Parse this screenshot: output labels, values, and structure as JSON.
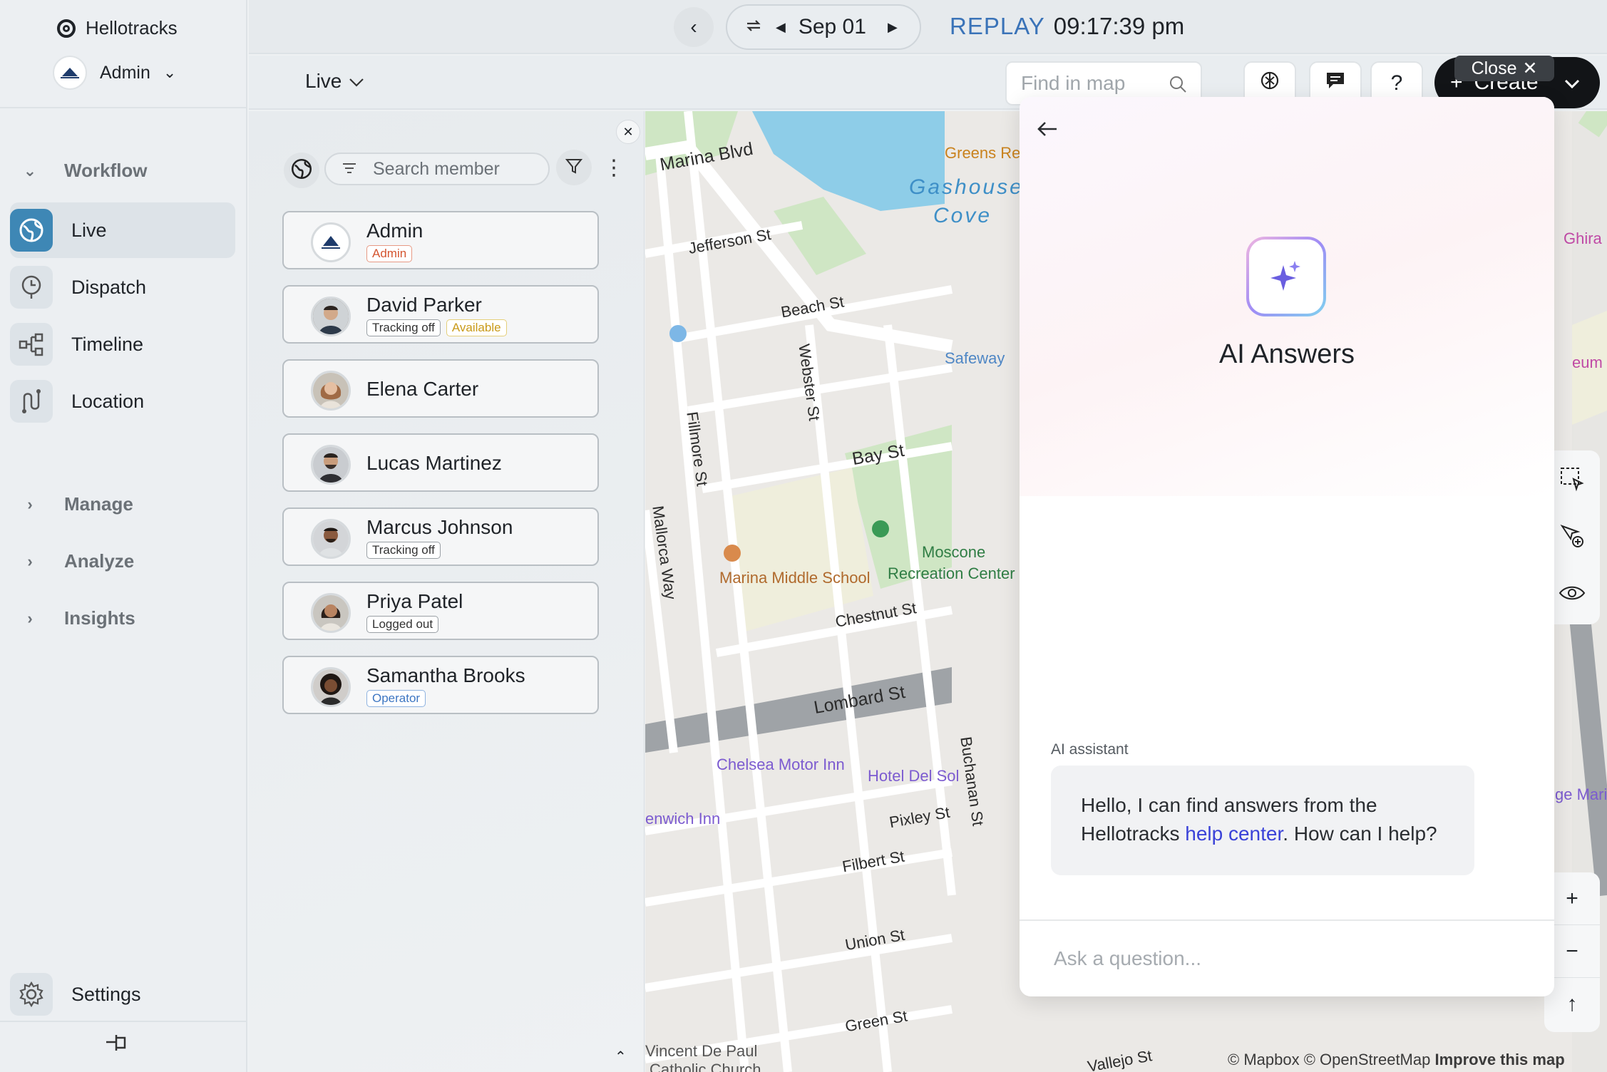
{
  "app": {
    "name": "Hellotracks",
    "account": "Admin"
  },
  "sidebar": {
    "groups": [
      {
        "label": "Workflow",
        "caret": "⌄"
      },
      {
        "label": "Manage",
        "caret": "›"
      },
      {
        "label": "Analyze",
        "caret": "›"
      },
      {
        "label": "Insights",
        "caret": "›"
      }
    ],
    "items": [
      {
        "label": "Live",
        "icon": "globe-icon",
        "active": true
      },
      {
        "label": "Dispatch",
        "icon": "dispatch-icon"
      },
      {
        "label": "Timeline",
        "icon": "timeline-icon"
      },
      {
        "label": "Location",
        "icon": "location-icon"
      }
    ],
    "settings": "Settings"
  },
  "topbar": {
    "date": "Sep 01",
    "replay_label": "REPLAY",
    "replay_time": "09:17:39 pm",
    "view": "Live",
    "find_placeholder": "Find in map",
    "help": "?",
    "create": "Create",
    "close": "Close"
  },
  "members": {
    "search_placeholder": "Search member",
    "list": [
      {
        "name": "Admin",
        "badges": [
          {
            "text": "Admin",
            "kind": "admin"
          }
        ]
      },
      {
        "name": "David Parker",
        "badges": [
          {
            "text": "Tracking off",
            "kind": "plain"
          },
          {
            "text": "Available",
            "kind": "available"
          }
        ]
      },
      {
        "name": "Elena Carter",
        "badges": []
      },
      {
        "name": "Lucas Martinez",
        "badges": []
      },
      {
        "name": "Marcus Johnson",
        "badges": [
          {
            "text": "Tracking off",
            "kind": "plain"
          }
        ]
      },
      {
        "name": "Priya Patel",
        "badges": [
          {
            "text": "Logged out",
            "kind": "plain"
          }
        ]
      },
      {
        "name": "Samantha Brooks",
        "badges": [
          {
            "text": "Operator",
            "kind": "operator"
          }
        ]
      }
    ]
  },
  "map": {
    "labels": {
      "marina_blvd": "Marina Blvd",
      "jefferson": "Jefferson St",
      "beach": "Beach St",
      "fillmore": "Fillmore St",
      "webster": "Webster St",
      "bay": "Bay St",
      "mallorca": "Mallorca Way",
      "chestnut": "Chestnut St",
      "lombard": "Lombard St",
      "pixley": "Pixley St",
      "filbert": "Filbert St",
      "union": "Union St",
      "green": "Green St",
      "vallejo": "Vallejo St",
      "buchanan": "Buchanan St",
      "safeway": "Safeway",
      "greens": "Greens Re",
      "gashouse": "Gashouse",
      "cove": "Cove",
      "marina_school": "Marina Middle School",
      "moscone": "Moscone",
      "moscone2": "Recreation Center",
      "chelsea": "Chelsea Motor Inn",
      "hotel_del_sol": "Hotel Del Sol",
      "greenwich": "enwich Inn",
      "vincent": "Vincent De Paul",
      "vincent2": "Catholic Church",
      "ghira": "Ghira",
      "eum": "eum",
      "ge_mari": "ge Mari"
    },
    "attribution": [
      "© Mapbox",
      "© OpenStreetMap",
      "Improve this map"
    ]
  },
  "ai": {
    "title": "AI Answers",
    "sender": "AI assistant",
    "message_before": "Hello, I can find answers from the Hellotracks ",
    "message_link": "help center",
    "message_after": ". How can I help?",
    "input_placeholder": "Ask a question..."
  }
}
